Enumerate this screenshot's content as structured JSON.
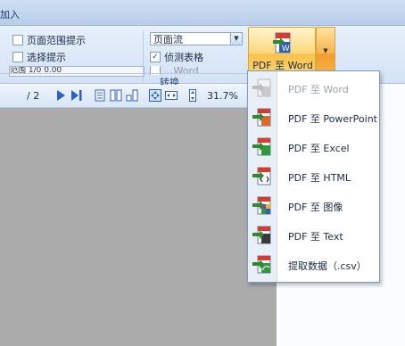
{
  "titlebar": {
    "text": "加入"
  },
  "ribbon": {
    "group_label": "转换",
    "checkboxes": [
      {
        "label": "页面范围提示",
        "checked": false
      },
      {
        "label": "选择提示",
        "checked": false
      },
      {
        "label": "侦测表格",
        "checked": true
      }
    ],
    "layout_select": {
      "value": "页面流"
    },
    "partial_field_text": "范围 1/0 0.00",
    "partial_checkbox_label": "...Word",
    "big_button": {
      "label": "PDF 至 Word",
      "icon": "pdf-to-word-icon"
    }
  },
  "toolbar": {
    "page_count": "/ 2",
    "zoom": "31.7%",
    "icons": [
      "next-page-icon",
      "last-page-icon",
      "single-page-icon",
      "multi-page-icon",
      "facing-page-icon",
      "fit-page-icon",
      "fit-width-icon",
      "fit-height-icon"
    ]
  },
  "menu": {
    "items": [
      {
        "label": "PDF 至 Word",
        "enabled": false,
        "icon": "word-doc-icon"
      },
      {
        "label": "PDF 至 PowerPoint",
        "enabled": true,
        "icon": "powerpoint-doc-icon"
      },
      {
        "label": "PDF 至 Excel",
        "enabled": true,
        "icon": "excel-doc-icon"
      },
      {
        "label": "PDF 至 HTML",
        "enabled": true,
        "icon": "html-doc-icon"
      },
      {
        "label": "PDF 至 图像",
        "enabled": true,
        "icon": "image-doc-icon"
      },
      {
        "label": "PDF 至 Text",
        "enabled": true,
        "icon": "text-doc-icon"
      },
      {
        "label": "提取数据（.csv）",
        "enabled": true,
        "icon": "csv-doc-icon"
      }
    ]
  },
  "colors": {
    "ribbon_bg": "#d3e2f5",
    "highlight_button": "#f9c24a",
    "canvas_bg": "#ababab",
    "menu_border": "#7b9bc7",
    "disabled_text": "#9aa3ad"
  }
}
